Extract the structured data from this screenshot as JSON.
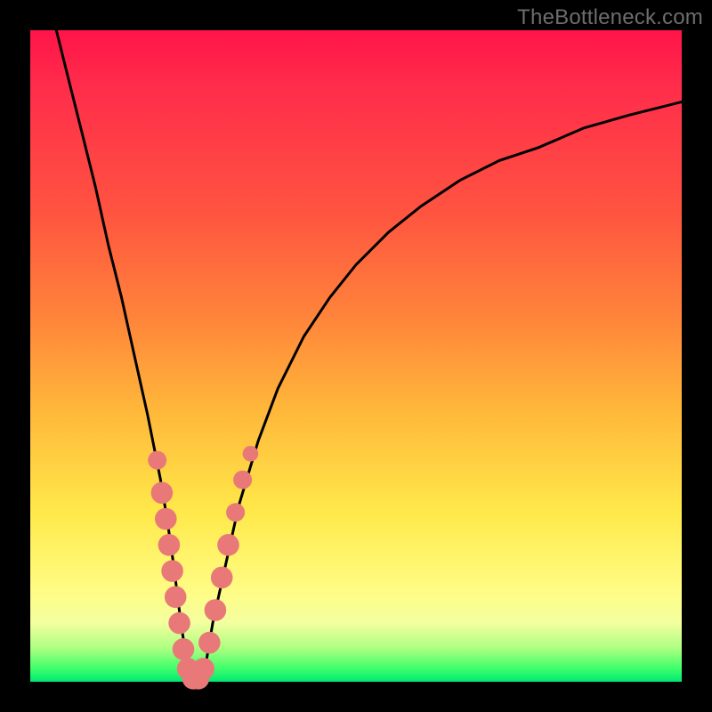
{
  "watermark": "TheBottleneck.com",
  "colors": {
    "frame": "#000000",
    "curve": "#000000",
    "marker_fill": "#e97979",
    "marker_stroke": "#d66868"
  },
  "chart_data": {
    "type": "line",
    "title": "",
    "xlabel": "",
    "ylabel": "",
    "xlim": [
      0,
      100
    ],
    "ylim": [
      0,
      100
    ],
    "series": [
      {
        "name": "bottleneck-curve",
        "x": [
          4,
          6,
          8,
          10,
          12,
          14,
          16,
          18,
          20,
          21,
          22,
          23,
          24,
          25,
          26,
          27,
          28,
          30,
          32,
          35,
          38,
          42,
          46,
          50,
          55,
          60,
          66,
          72,
          78,
          85,
          92,
          100
        ],
        "y": [
          100,
          92,
          84,
          76,
          67,
          59,
          50,
          41,
          31,
          25,
          18,
          10,
          3,
          0,
          0,
          3,
          9,
          18,
          27,
          37,
          45,
          53,
          59,
          64,
          69,
          73,
          77,
          80,
          82,
          85,
          87,
          89
        ]
      }
    ],
    "markers": {
      "name": "highlighted-points",
      "points": [
        {
          "x": 19.5,
          "y": 34,
          "r": 1.2
        },
        {
          "x": 20.2,
          "y": 29,
          "r": 1.4
        },
        {
          "x": 20.8,
          "y": 25,
          "r": 1.4
        },
        {
          "x": 21.3,
          "y": 21,
          "r": 1.4
        },
        {
          "x": 21.8,
          "y": 17,
          "r": 1.4
        },
        {
          "x": 22.3,
          "y": 13,
          "r": 1.4
        },
        {
          "x": 22.9,
          "y": 9,
          "r": 1.4
        },
        {
          "x": 23.5,
          "y": 5,
          "r": 1.4
        },
        {
          "x": 24.2,
          "y": 2,
          "r": 1.4
        },
        {
          "x": 25.0,
          "y": 0.5,
          "r": 1.4
        },
        {
          "x": 25.8,
          "y": 0.5,
          "r": 1.4
        },
        {
          "x": 26.6,
          "y": 2,
          "r": 1.4
        },
        {
          "x": 27.5,
          "y": 6,
          "r": 1.4
        },
        {
          "x": 28.4,
          "y": 11,
          "r": 1.4
        },
        {
          "x": 29.4,
          "y": 16,
          "r": 1.4
        },
        {
          "x": 30.4,
          "y": 21,
          "r": 1.4
        },
        {
          "x": 31.5,
          "y": 26,
          "r": 1.2
        },
        {
          "x": 32.6,
          "y": 31,
          "r": 1.2
        },
        {
          "x": 33.8,
          "y": 35,
          "r": 1.0
        }
      ]
    }
  }
}
